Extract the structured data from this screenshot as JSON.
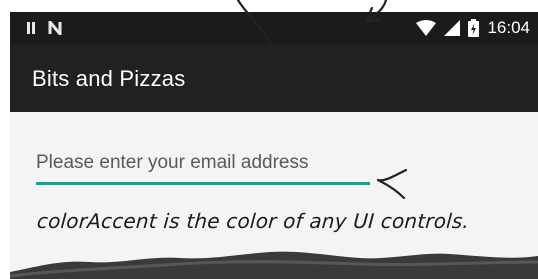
{
  "status_bar": {
    "time": "16:04",
    "icons": [
      "pause-icon",
      "n-icon",
      "wifi-icon",
      "signal-icon",
      "battery-charging-icon"
    ]
  },
  "app_bar": {
    "title": "Bits and Pizzas"
  },
  "form": {
    "email_placeholder": "Please enter your email address",
    "email_value": ""
  },
  "annotation": {
    "text": "colorAccent is the color of any UI controls."
  },
  "colors": {
    "status_bar": "#1b1b1b",
    "app_bar": "#212121",
    "content_background": "#f4f4f4",
    "accent": "#219d8b",
    "title_text": "#ffffff"
  }
}
